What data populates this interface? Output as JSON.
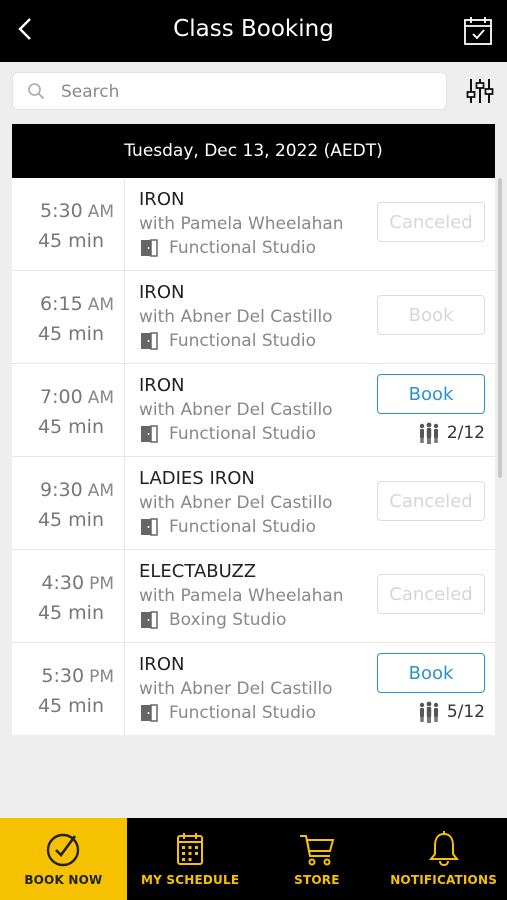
{
  "header": {
    "title": "Class Booking",
    "back_icon": "chevron-left-icon",
    "calendar_icon": "calendar-check-icon"
  },
  "search": {
    "placeholder": "Search",
    "value": "",
    "icon": "search-icon",
    "filter_icon": "sliders-icon"
  },
  "date_header": "Tuesday, Dec 13, 2022 (AEDT)",
  "classes": [
    {
      "time": "5:30",
      "ampm": "AM",
      "duration": "45 min",
      "name": "IRON",
      "instructor": "with Pamela Wheelahan",
      "location": "Functional Studio",
      "button": "Canceled",
      "state": "disabled",
      "spots": ""
    },
    {
      "time": "6:15",
      "ampm": "AM",
      "duration": "45 min",
      "name": "IRON",
      "instructor": "with Abner Del Castillo",
      "location": "Functional Studio",
      "button": "Book",
      "state": "disabled",
      "spots": ""
    },
    {
      "time": "7:00",
      "ampm": "AM",
      "duration": "45 min",
      "name": "IRON",
      "instructor": "with Abner Del Castillo",
      "location": "Functional Studio",
      "button": "Book",
      "state": "active",
      "spots": "2/12"
    },
    {
      "time": "9:30",
      "ampm": "AM",
      "duration": "45 min",
      "name": "LADIES IRON",
      "instructor": "with Abner Del Castillo",
      "location": "Functional Studio",
      "button": "Canceled",
      "state": "disabled",
      "spots": ""
    },
    {
      "time": "4:30",
      "ampm": "PM",
      "duration": "45 min",
      "name": "ELECTABUZZ",
      "instructor": "with Pamela Wheelahan",
      "location": "Boxing Studio",
      "button": "Canceled",
      "state": "disabled",
      "spots": ""
    },
    {
      "time": "5:30",
      "ampm": "PM",
      "duration": "45 min",
      "name": "IRON",
      "instructor": "with Abner Del Castillo",
      "location": "Functional Studio",
      "button": "Book",
      "state": "active",
      "spots": "5/12"
    }
  ],
  "tabs": [
    {
      "label": "BOOK NOW",
      "icon": "check-circle-icon",
      "active": true
    },
    {
      "label": "MY SCHEDULE",
      "icon": "calendar-icon",
      "active": false
    },
    {
      "label": "STORE",
      "icon": "cart-icon",
      "active": false
    },
    {
      "label": "NOTIFICATIONS",
      "icon": "bell-icon",
      "active": false
    }
  ],
  "colors": {
    "accent": "#f6c200",
    "book_blue": "#2a94c8",
    "header_bg": "#000000",
    "page_bg": "#eeeeee"
  }
}
